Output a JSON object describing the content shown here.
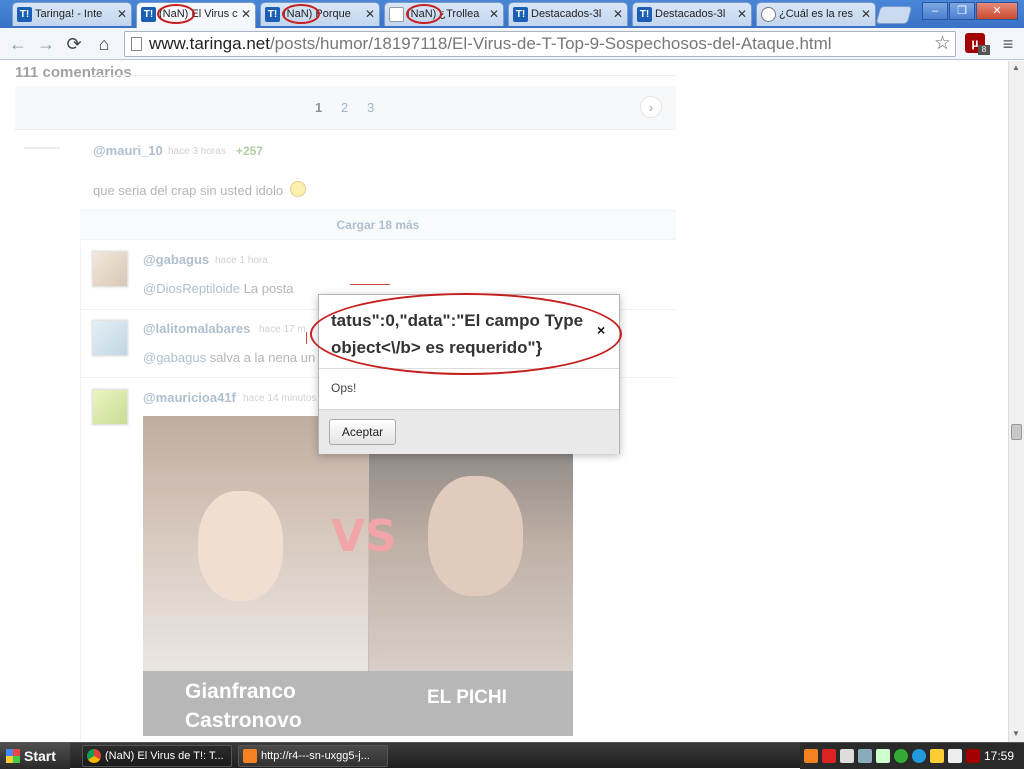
{
  "browser": {
    "tabs": [
      {
        "title": "Taringa! - Inte",
        "icon": "taringa-favicon"
      },
      {
        "title": "(NaN) El Virus c",
        "icon": "taringa-favicon"
      },
      {
        "title": "(NaN) Porque",
        "icon": "taringa-favicon"
      },
      {
        "title": "(NaN) ¿Trollea",
        "icon": "page-icon"
      },
      {
        "title": "Destacados-3l",
        "icon": "taringa-favicon"
      },
      {
        "title": "Destacados-3l",
        "icon": "taringa-favicon"
      },
      {
        "title": "¿Cuál es la res",
        "icon": "cube-icon"
      }
    ],
    "favicon_letter": "T!",
    "url_host": "www.taringa.net",
    "url_path": "/posts/humor/18197118/El-Virus-de-T-Top-9-Sospechosos-del-Ataque.html",
    "extension_letter": "µ",
    "extension_badge": "8"
  },
  "page": {
    "comments_count_label": "111 comentarios",
    "pagination": {
      "pages": [
        "1",
        "2",
        "3"
      ],
      "current": "1"
    },
    "comments": [
      {
        "user": "@mauri_10",
        "time": "hace 3 horas",
        "points": "+257",
        "text": "que seria del crap sin usted idolo"
      },
      {
        "user": "@gabagus",
        "time": "hace 1 hora",
        "mention": "@DiosReptiloide",
        "text": "La posta"
      },
      {
        "user": "@lalitomalabares",
        "time": "hace 17 m",
        "mention": "@gabagus",
        "text": "salva a la nena un"
      },
      {
        "user": "@mauricioa41f",
        "time": "hace 14 minutos"
      }
    ],
    "load_more_label": "Cargar 18 más",
    "image": {
      "vs": "VS",
      "caption_left": "Gianfranco\nCastronovo",
      "caption_right": "EL PICHI"
    }
  },
  "dialog": {
    "title": "tatus\":0,\"data\":\"El campo Type object<\\/b> es requerido\"}",
    "close_glyph": "×",
    "message": "Ops!",
    "accept_label": "Aceptar"
  },
  "taskbar": {
    "start_label": "Start",
    "tasks": [
      {
        "label": "(NaN) El Virus de T!: T...",
        "icon": "chrome-icon"
      },
      {
        "label": "http://r4---sn-uxgg5-j...",
        "icon": "vlc-icon"
      }
    ],
    "clock": "17:59"
  },
  "colors": {
    "annotation_red": "#c61f1f",
    "link_blue": "#6d8aa5",
    "points_green": "#6fa55a"
  }
}
